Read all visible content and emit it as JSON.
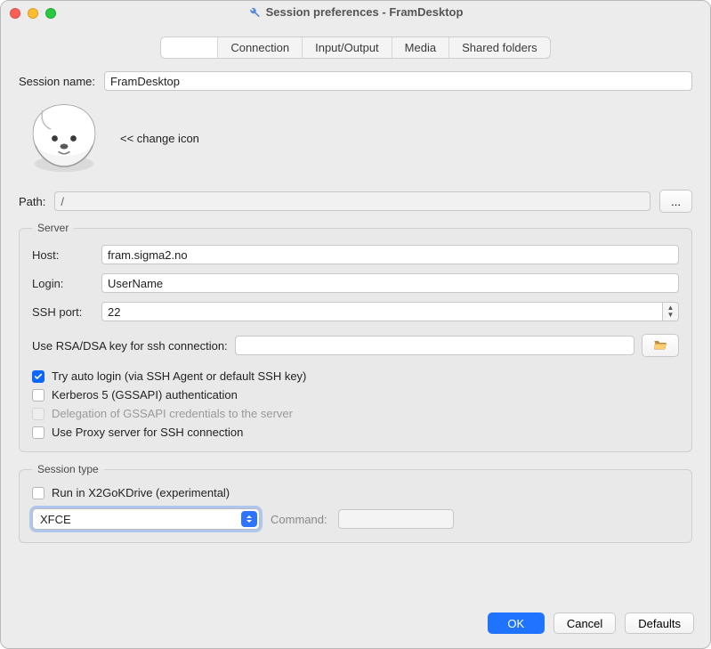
{
  "window": {
    "title": "Session preferences - FramDesktop"
  },
  "tabs": {
    "blank": "",
    "connection": "Connection",
    "io": "Input/Output",
    "media": "Media",
    "shared": "Shared folders"
  },
  "session": {
    "name_label": "Session name:",
    "name_value": "FramDesktop",
    "change_icon": "<< change icon",
    "path_label": "Path:",
    "path_value": "/",
    "browse_label": "..."
  },
  "server": {
    "legend": "Server",
    "host_label": "Host:",
    "host_value": "fram.sigma2.no",
    "login_label": "Login:",
    "login_value": "UserName",
    "sshport_label": "SSH port:",
    "sshport_value": "22",
    "rsa_label": "Use RSA/DSA key for ssh connection:",
    "rsa_value": "",
    "chk_autologin": "Try auto login (via SSH Agent or default SSH key)",
    "chk_kerberos": "Kerberos 5 (GSSAPI) authentication",
    "chk_delegation": "Delegation of GSSAPI credentials to the server",
    "chk_proxy": "Use Proxy server for SSH connection"
  },
  "session_type": {
    "legend": "Session type",
    "chk_kdrive": "Run in X2GoKDrive (experimental)",
    "select_value": "XFCE",
    "command_label": "Command:",
    "command_value": ""
  },
  "footer": {
    "ok": "OK",
    "cancel": "Cancel",
    "defaults": "Defaults"
  }
}
